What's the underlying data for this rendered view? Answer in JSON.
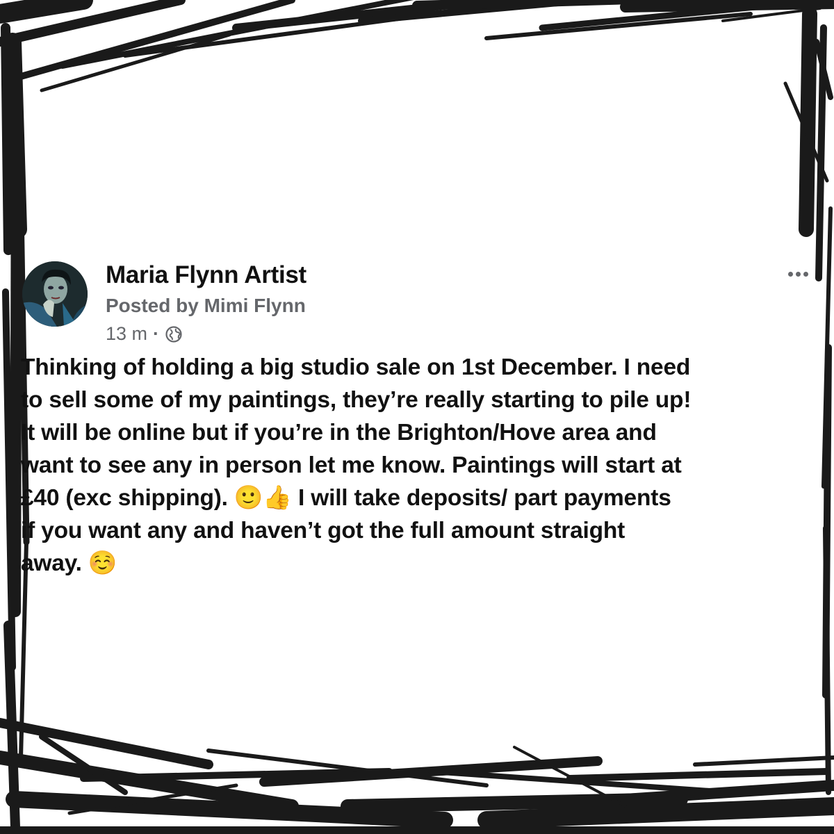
{
  "post": {
    "author": "Maria Flynn Artist",
    "posted_by": "Posted by Mimi Flynn",
    "timestamp": "13 m",
    "separator": "·",
    "audience_icon": "globe-icon",
    "more_icon": "more-options-icon",
    "body_text": "Thinking of holding a big studio sale on 1st December. I need\nto sell some of my paintings, they’re really starting to pile up!\nIt will be online but if you’re in the Brighton/Hove area and\nwant to see any in person let me know. Paintings will start at\n£40 (exc shipping). 🙂👍 I will take deposits/ part payments\nif you want any and haven’t got the full amount straight\naway. ☺️"
  },
  "colors": {
    "text_primary": "#111111",
    "text_secondary": "#65676b",
    "frame": "#1a1a1a",
    "background": "#ffffff"
  }
}
